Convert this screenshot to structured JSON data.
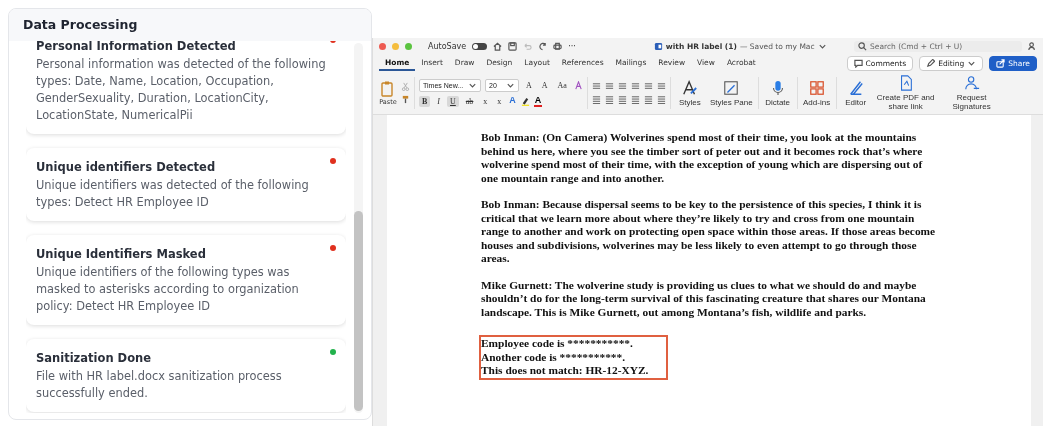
{
  "panel": {
    "title": "Data Processing",
    "events": [
      {
        "title": "Personal Information Detected",
        "description": "Personal information was detected of the following types: Date, Name, Location, Occupation, GenderSexuality, Duration, LocationCity, LocationState, NumericalPii",
        "color": "#e0301e"
      },
      {
        "title": "Unique identifiers Detected",
        "description": "Unique identifiers was detected of the following types: Detect HR Employee ID",
        "color": "#e0301e"
      },
      {
        "title": "Unique Identifiers Masked",
        "description": "Unique identifiers of the following types was masked to asterisks according to organization policy: Detect HR Employee ID",
        "color": "#e0301e"
      },
      {
        "title": "Sanitization Done",
        "description": "File with HR label.docx sanitization process successfully ended.",
        "color": "#22b24c"
      }
    ]
  },
  "word": {
    "titlebar": {
      "autosave_label": "AutoSave",
      "autosave_on": false,
      "more": "···",
      "document_title": "with HR label (1)",
      "saved_status": "— Saved to my Mac",
      "search_placeholder": "Search (Cmd + Ctrl + U)"
    },
    "tabs": [
      {
        "label": "Home",
        "selected": true
      },
      {
        "label": "Insert",
        "selected": false
      },
      {
        "label": "Draw",
        "selected": false
      },
      {
        "label": "Design",
        "selected": false
      },
      {
        "label": "Layout",
        "selected": false
      },
      {
        "label": "References",
        "selected": false
      },
      {
        "label": "Mailings",
        "selected": false
      },
      {
        "label": "Review",
        "selected": false
      },
      {
        "label": "View",
        "selected": false
      },
      {
        "label": "Acrobat",
        "selected": false
      }
    ],
    "comments_button": "Comments",
    "editing_button": "Editing",
    "share_button": "Share",
    "ribbon": {
      "paste_label": "Paste",
      "font_name": "Times New...",
      "font_size": "20",
      "grow_font": "A",
      "shrink_font": "A",
      "change_case": "Aa",
      "format_buttons": [
        {
          "kind": "bold",
          "label": "B",
          "on": true
        },
        {
          "kind": "italic",
          "label": "I",
          "on": false
        },
        {
          "kind": "underline",
          "label": "U",
          "on": true
        },
        {
          "kind": "strike",
          "label": "ab",
          "on": false
        },
        {
          "kind": "sub",
          "label": "x",
          "on": false
        },
        {
          "kind": "sup",
          "label": "x",
          "on": false
        }
      ],
      "color_letters": [
        "A",
        "A"
      ],
      "big_buttons": [
        {
          "kind": "styles",
          "label": "Styles"
        },
        {
          "kind": "styles-pane",
          "label": "Styles Pane"
        },
        {
          "kind": "dictate",
          "label": "Dictate"
        },
        {
          "kind": "addins",
          "label": "Add-ins"
        },
        {
          "kind": "editor",
          "label": "Editor"
        },
        {
          "kind": "pdf",
          "label": "Create PDF and share link"
        },
        {
          "kind": "sign",
          "label": "Request Signatures"
        }
      ]
    },
    "document": {
      "blocks": [
        {
          "kind": "paragraph",
          "text": "Bob Inman: (On Camera) Wolverines spend most of their time, you look at the mountains behind us here, where you see the timber sort of peter out and it becomes rock that’s where wolverine spend most of their time, with the exception of young which are dispersing out of one mountain range and into another."
        },
        {
          "kind": "paragraph",
          "text": "Bob Inman: Because dispersal seems to be key to the persistence of this species, I think it is critical that we learn more about where they’re likely to try and cross from one mountain range to another and work on protecting open space within those areas.  If those areas become houses and subdivisions, wolverines may be less likely to even attempt to go through those areas."
        },
        {
          "kind": "paragraph",
          "text": "Mike Gurnett: The wolverine study is providing us clues to what we should do and maybe shouldn’t do for the long-term survival of this fascinating creature that shares our Montana landscape. This is Mike Gurnett, out among Montana’s fish, wildlife and parks."
        },
        {
          "kind": "highlight",
          "lines": [
            "Employee code is ***********.",
            "Another code is ***********.",
            "This does not match: HR-12-XYZ."
          ]
        }
      ]
    }
  }
}
